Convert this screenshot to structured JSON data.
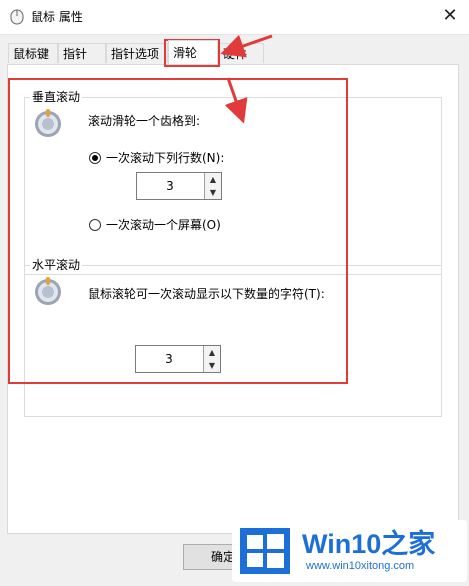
{
  "window": {
    "title": "鼠标 属性",
    "close_symbol": "✕"
  },
  "tabs": [
    {
      "label": "鼠标键",
      "active": false
    },
    {
      "label": "指针",
      "active": false
    },
    {
      "label": "指针选项",
      "active": false
    },
    {
      "label": "滑轮",
      "active": true
    },
    {
      "label": "硬件",
      "active": false
    }
  ],
  "vertical": {
    "title": "垂直滚动",
    "description": "滚动滑轮一个齿格到:",
    "option_lines": "一次滚动下列行数(N):",
    "option_lines_checked": true,
    "lines_value": "3",
    "option_screen": "一次滚动一个屏幕(O)",
    "option_screen_checked": false
  },
  "horizontal": {
    "title": "水平滚动",
    "description": "鼠标滚轮可一次滚动显示以下数量的字符(T):",
    "chars_value": "3"
  },
  "buttons": {
    "ok_label": "确定"
  },
  "watermark": {
    "brand": "Win10",
    "brand_cn": "之家",
    "url": "www.win10xitong.com"
  },
  "colors": {
    "highlight_red": "#e03a3a",
    "brand_blue": "#1d6fd8"
  },
  "icons": [
    "mouse-icon",
    "close-icon",
    "wheel-icon",
    "spin-up-arrow-icon",
    "spin-down-arrow-icon",
    "windows-logo-icon"
  ]
}
